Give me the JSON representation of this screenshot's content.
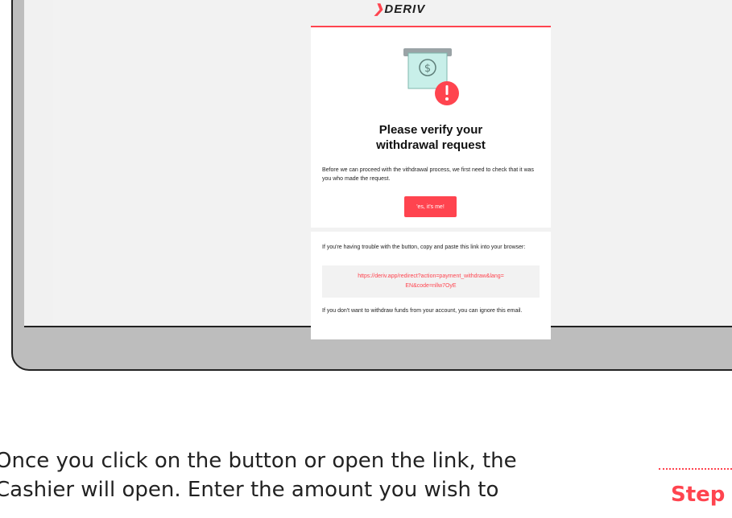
{
  "email": {
    "brand": "DERIV",
    "heading_line1": "Please verify your",
    "heading_line2": "withdrawal request",
    "intro": "Before we can proceed with the vithdrawal process, we first need to check that it was you who made the request.",
    "button_label": "'es, it's me!",
    "trouble_text": "If you're having trouble with the button, copy and paste this link into your browser:",
    "link_line1": "https://deriv.app/redirect?action=payment_withdraw&lang=",
    "link_line2": "EN&code=nllw7OyE",
    "ignore_text": "If you don't want to withdraw funds from your account, you can ignore this email."
  },
  "instructions": {
    "line1": "Once you click on the button or open the link, the",
    "line2": "Cashier will open. Enter the amount you wish to",
    "step_label": "Step"
  },
  "colors": {
    "accent": "#ff444f",
    "illustration": "#c8efe9"
  }
}
